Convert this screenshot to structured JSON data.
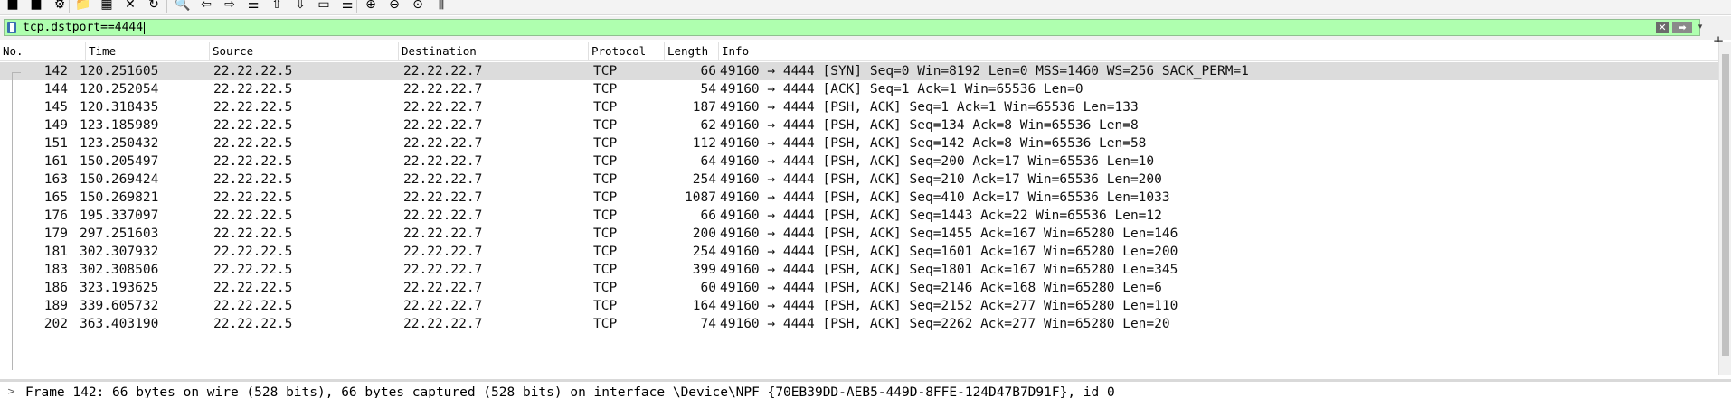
{
  "toolbar": {
    "icons": [
      "stop-capture-icon",
      "restart-capture-icon",
      "options-icon",
      "open-file-icon",
      "save-file-icon",
      "close-file-icon",
      "reload-icon",
      "find-icon",
      "back-icon",
      "forward-icon",
      "go-to-packet-icon",
      "first-packet-icon",
      "last-packet-icon",
      "autoscroll-icon",
      "colorize-icon",
      "zoom-in-icon",
      "zoom-out-icon",
      "normal-size-icon",
      "resize-columns-icon"
    ],
    "glyphs": [
      "■",
      "■",
      "⚙",
      "📁",
      "▦",
      "✕",
      "↻",
      "🔍",
      "⇦",
      "⇨",
      "☰",
      "⇧",
      "⇩",
      "▭",
      "☰",
      "⊕",
      "⊖",
      "⊙",
      "⫼"
    ]
  },
  "filter": {
    "value": "tcp.dstport==4444",
    "background": "#afffaf"
  },
  "columns": [
    "No.",
    "Time",
    "Source",
    "Destination",
    "Protocol",
    "Length",
    "Info"
  ],
  "packets": [
    {
      "no": "142",
      "time": "120.251605",
      "src": "22.22.22.5",
      "dst": "22.22.22.7",
      "proto": "TCP",
      "len": "66",
      "info": "49160 → 4444 [SYN] Seq=0 Win=8192 Len=0 MSS=1460 WS=256 SACK_PERM=1",
      "selected": true
    },
    {
      "no": "144",
      "time": "120.252054",
      "src": "22.22.22.5",
      "dst": "22.22.22.7",
      "proto": "TCP",
      "len": "54",
      "info": "49160 → 4444 [ACK] Seq=1 Ack=1 Win=65536 Len=0"
    },
    {
      "no": "145",
      "time": "120.318435",
      "src": "22.22.22.5",
      "dst": "22.22.22.7",
      "proto": "TCP",
      "len": "187",
      "info": "49160 → 4444 [PSH, ACK] Seq=1 Ack=1 Win=65536 Len=133"
    },
    {
      "no": "149",
      "time": "123.185989",
      "src": "22.22.22.5",
      "dst": "22.22.22.7",
      "proto": "TCP",
      "len": "62",
      "info": "49160 → 4444 [PSH, ACK] Seq=134 Ack=8 Win=65536 Len=8"
    },
    {
      "no": "151",
      "time": "123.250432",
      "src": "22.22.22.5",
      "dst": "22.22.22.7",
      "proto": "TCP",
      "len": "112",
      "info": "49160 → 4444 [PSH, ACK] Seq=142 Ack=8 Win=65536 Len=58"
    },
    {
      "no": "161",
      "time": "150.205497",
      "src": "22.22.22.5",
      "dst": "22.22.22.7",
      "proto": "TCP",
      "len": "64",
      "info": "49160 → 4444 [PSH, ACK] Seq=200 Ack=17 Win=65536 Len=10"
    },
    {
      "no": "163",
      "time": "150.269424",
      "src": "22.22.22.5",
      "dst": "22.22.22.7",
      "proto": "TCP",
      "len": "254",
      "info": "49160 → 4444 [PSH, ACK] Seq=210 Ack=17 Win=65536 Len=200"
    },
    {
      "no": "165",
      "time": "150.269821",
      "src": "22.22.22.5",
      "dst": "22.22.22.7",
      "proto": "TCP",
      "len": "1087",
      "info": "49160 → 4444 [PSH, ACK] Seq=410 Ack=17 Win=65536 Len=1033"
    },
    {
      "no": "176",
      "time": "195.337097",
      "src": "22.22.22.5",
      "dst": "22.22.22.7",
      "proto": "TCP",
      "len": "66",
      "info": "49160 → 4444 [PSH, ACK] Seq=1443 Ack=22 Win=65536 Len=12"
    },
    {
      "no": "179",
      "time": "297.251603",
      "src": "22.22.22.5",
      "dst": "22.22.22.7",
      "proto": "TCP",
      "len": "200",
      "info": "49160 → 4444 [PSH, ACK] Seq=1455 Ack=167 Win=65280 Len=146"
    },
    {
      "no": "181",
      "time": "302.307932",
      "src": "22.22.22.5",
      "dst": "22.22.22.7",
      "proto": "TCP",
      "len": "254",
      "info": "49160 → 4444 [PSH, ACK] Seq=1601 Ack=167 Win=65280 Len=200"
    },
    {
      "no": "183",
      "time": "302.308506",
      "src": "22.22.22.5",
      "dst": "22.22.22.7",
      "proto": "TCP",
      "len": "399",
      "info": "49160 → 4444 [PSH, ACK] Seq=1801 Ack=167 Win=65280 Len=345"
    },
    {
      "no": "186",
      "time": "323.193625",
      "src": "22.22.22.5",
      "dst": "22.22.22.7",
      "proto": "TCP",
      "len": "60",
      "info": "49160 → 4444 [PSH, ACK] Seq=2146 Ack=168 Win=65280 Len=6"
    },
    {
      "no": "189",
      "time": "339.605732",
      "src": "22.22.22.5",
      "dst": "22.22.22.7",
      "proto": "TCP",
      "len": "164",
      "info": "49160 → 4444 [PSH, ACK] Seq=2152 Ack=277 Win=65280 Len=110"
    },
    {
      "no": "202",
      "time": "363.403190",
      "src": "22.22.22.5",
      "dst": "22.22.22.7",
      "proto": "TCP",
      "len": "74",
      "info": "49160 → 4444 [PSH, ACK] Seq=2262 Ack=277 Win=65280 Len=20"
    }
  ],
  "details": {
    "text": "Frame 142: 66 bytes on wire (528 bits), 66 bytes captured (528 bits) on interface \\Device\\NPF_{70EB39DD-AEB5-449D-8FFE-124D47B7D91F}, id 0"
  }
}
